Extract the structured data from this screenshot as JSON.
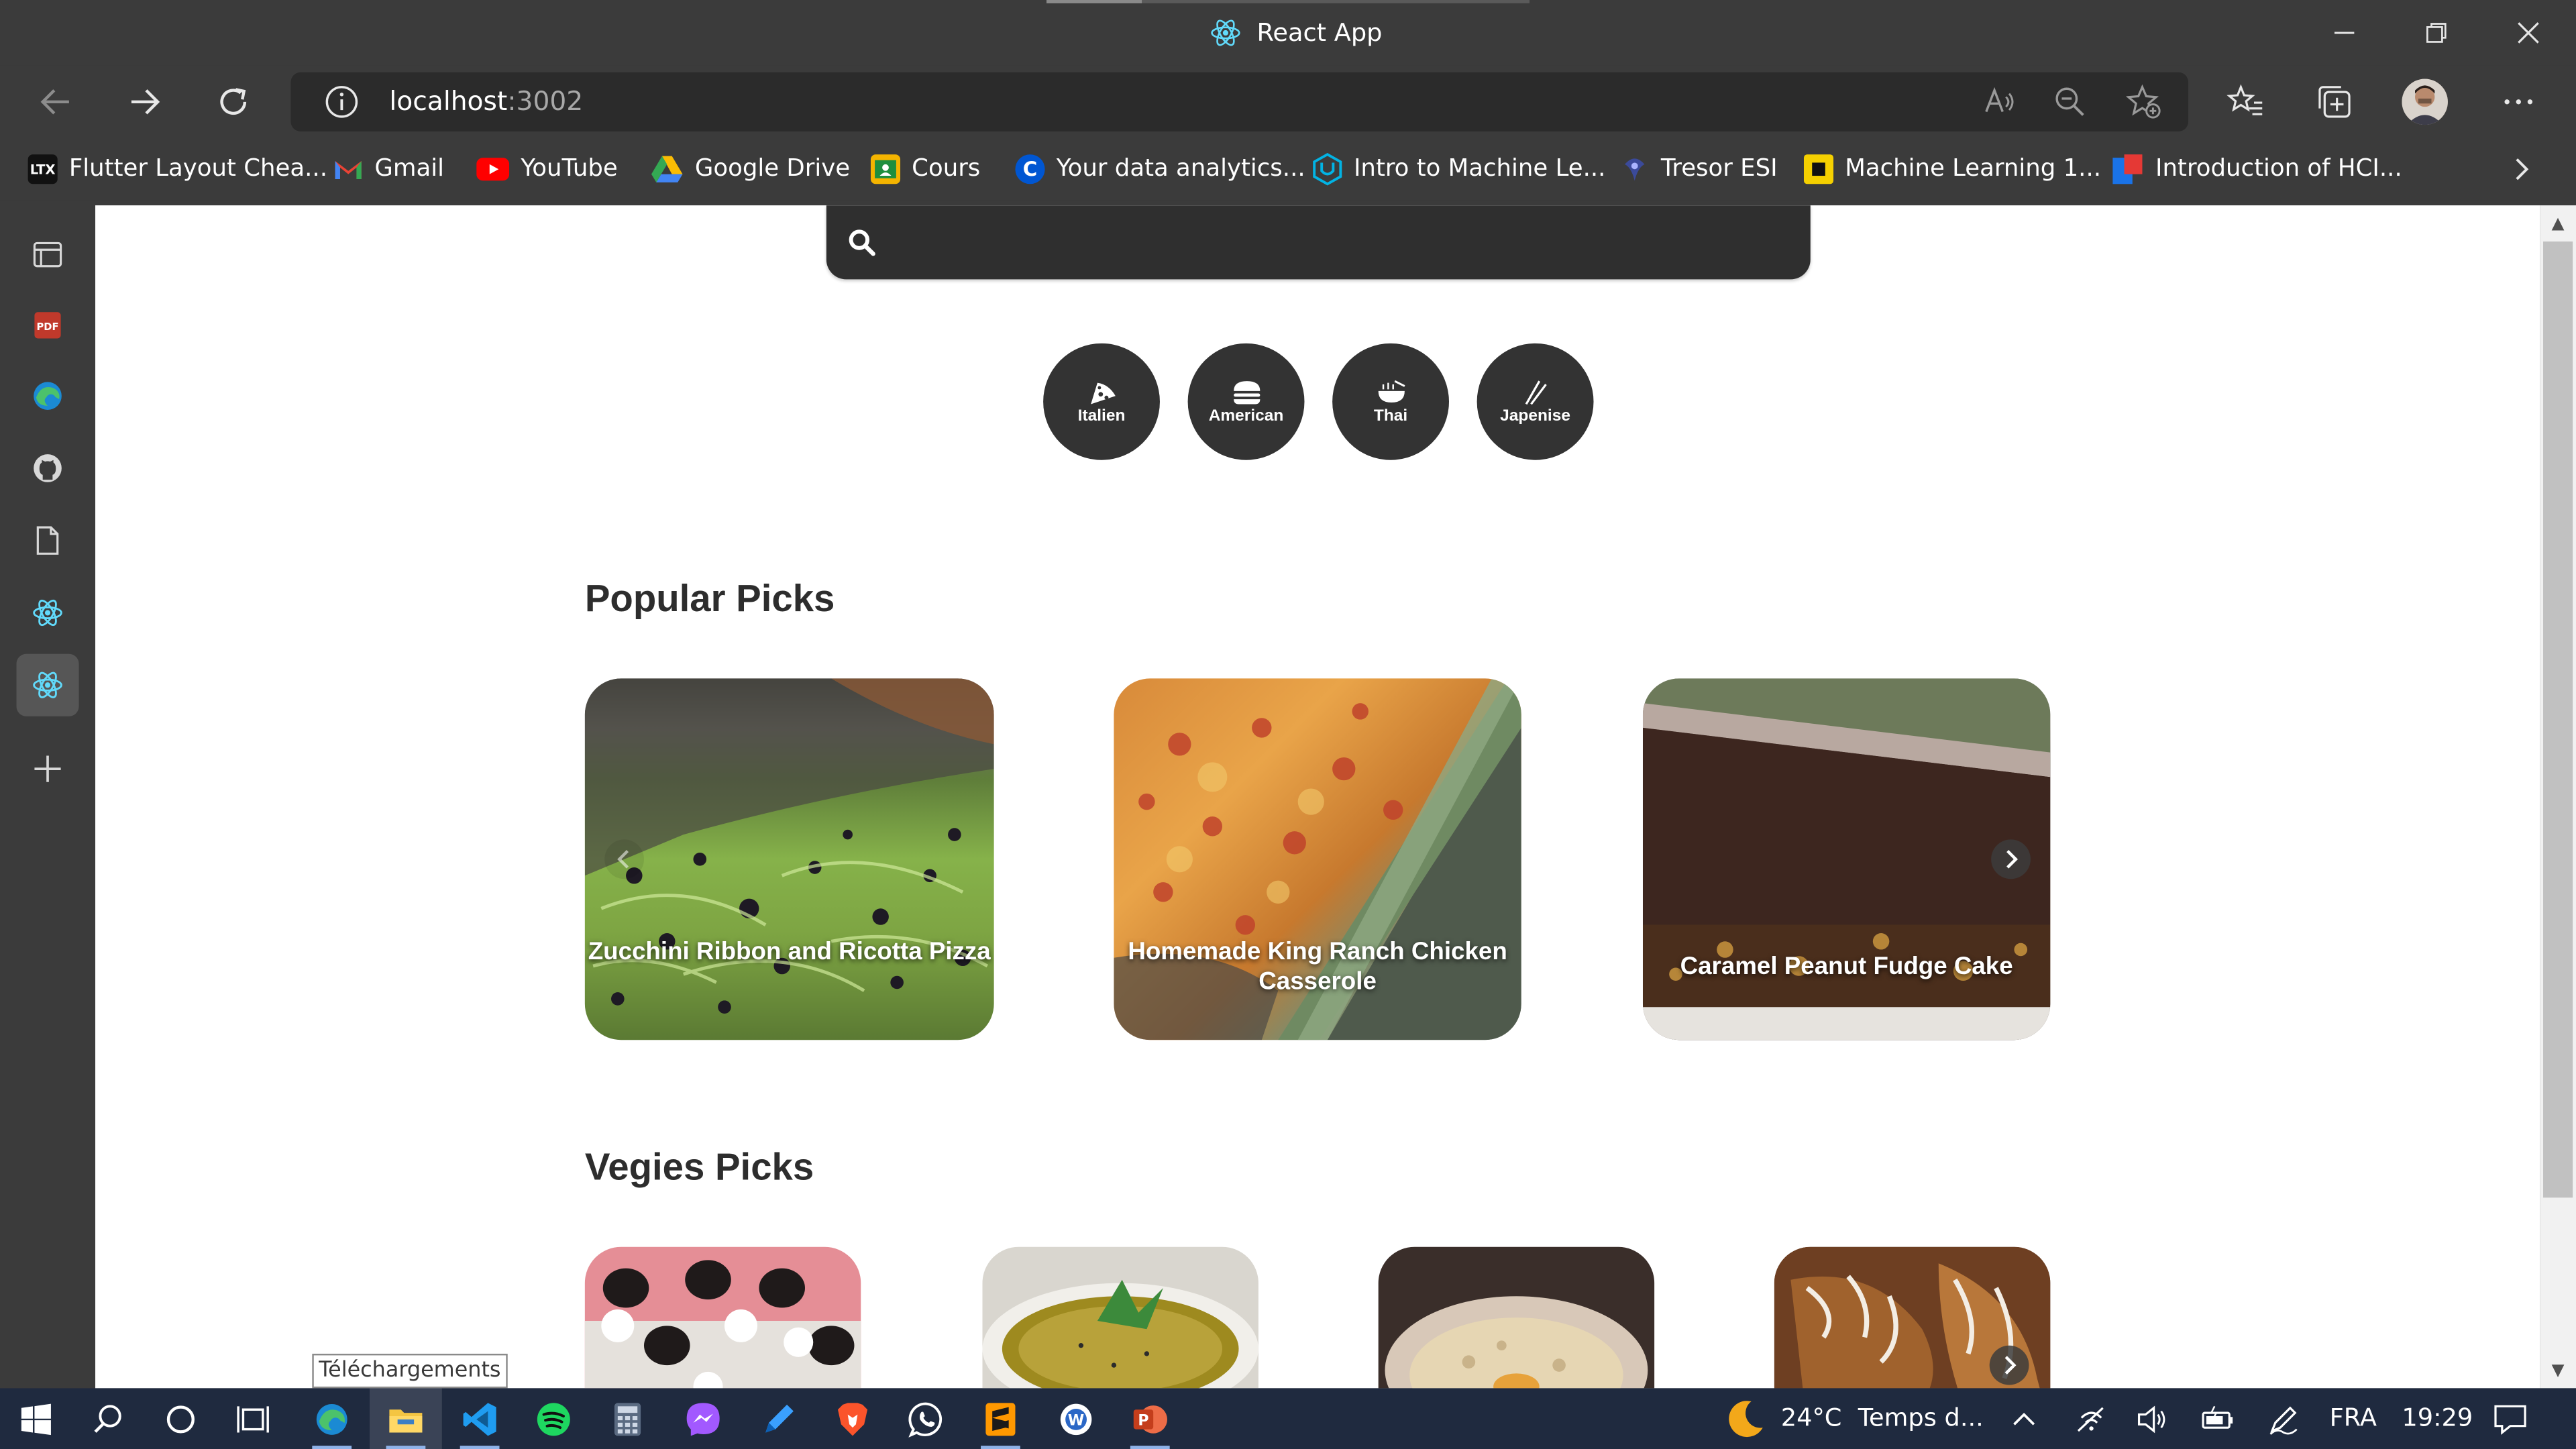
{
  "window": {
    "title": "React App"
  },
  "address": {
    "host": "localhost",
    "port": ":3002"
  },
  "bookmarks": [
    {
      "label": "Flutter Layout Chea...",
      "icon": "ltx-icon",
      "color": "#1a1a1a"
    },
    {
      "label": "Gmail",
      "icon": "gmail-icon",
      "color": "#ea4335"
    },
    {
      "label": "YouTube",
      "icon": "youtube-icon",
      "color": "#ff0000"
    },
    {
      "label": "Google Drive",
      "icon": "google-drive-icon",
      "color": "#34a853"
    },
    {
      "label": "Cours",
      "icon": "classroom-icon",
      "color": "#f4b400"
    },
    {
      "label": "Your data analytics...",
      "icon": "coursera-icon",
      "color": "#0056d2"
    },
    {
      "label": "Intro to Machine Le...",
      "icon": "udacity-icon",
      "color": "#02b3e4"
    },
    {
      "label": "Tresor ESI",
      "icon": "tresor-icon",
      "color": "#3b4a9a"
    },
    {
      "label": "Machine Learning 1...",
      "icon": "ml-icon",
      "color": "#f5d000"
    },
    {
      "label": "Introduction of HCI...",
      "icon": "hci-icon",
      "color": "#1a73e8"
    }
  ],
  "search": {
    "placeholder": ""
  },
  "categories": [
    {
      "label": "Italien",
      "icon": "pizza-icon"
    },
    {
      "label": "American",
      "icon": "burger-icon"
    },
    {
      "label": "Thai",
      "icon": "noodles-icon"
    },
    {
      "label": "Japenise",
      "icon": "chopsticks-icon"
    }
  ],
  "popular": {
    "title": "Popular Picks",
    "items": [
      {
        "label": "Zucchini Ribbon and Ricotta Pizza"
      },
      {
        "label": "Homemade King Ranch Chicken Casserole"
      },
      {
        "label": "Caramel Peanut Fudge Cake"
      }
    ]
  },
  "veggie": {
    "title": "Vegies Picks"
  },
  "downloads": {
    "label": "Téléchargements"
  },
  "taskbar": {
    "temperature": "24°C",
    "weather": "Temps d...",
    "language": "FRA",
    "time": "19:29"
  },
  "colors": {
    "chrome": "#3b3b3b",
    "taskbar": "#1f2a3f",
    "category_bg": "#333333",
    "searchbar": "#2f2f2f"
  }
}
